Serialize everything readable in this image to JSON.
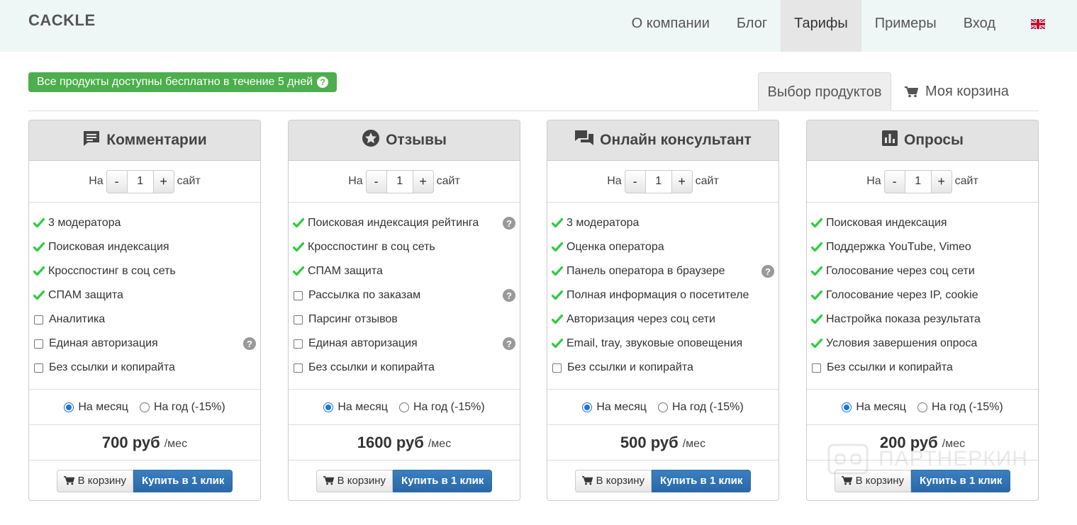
{
  "brand": "CACKLE",
  "nav": {
    "items": [
      "О компании",
      "Блог",
      "Тарифы",
      "Примеры",
      "Вход"
    ],
    "active": "Тарифы",
    "language_icon": "uk-flag-icon"
  },
  "promo": {
    "text": "Все продукты доступны бесплатно в течение 5 дней",
    "help_icon": "question-circle-icon"
  },
  "tabs": {
    "products": "Выбор продуктов",
    "cart": "Моя корзина"
  },
  "cards": [
    {
      "title": "Комментарии",
      "icon": "comment-icon",
      "qty_prefix": "На",
      "qty_value": "1",
      "qty_suffix": "сайт",
      "minus": "-",
      "plus": "+",
      "features": [
        {
          "label": "3 модератора",
          "included": true,
          "help": false
        },
        {
          "label": "Поисковая индексация",
          "included": true,
          "help": false
        },
        {
          "label": "Кросспостинг в соц сеть",
          "included": true,
          "help": false
        },
        {
          "label": "СПАМ защита",
          "included": true,
          "help": false
        },
        {
          "label": "Аналитика",
          "included": false,
          "help": false
        },
        {
          "label": "Единая авторизация",
          "included": false,
          "help": true
        },
        {
          "label": "Без ссылки и копирайта",
          "included": false,
          "help": false
        }
      ],
      "period_month": "На месяц",
      "period_year": "На год (-15%)",
      "price": "700 руб",
      "price_unit": "/мес",
      "cart_button": "В корзину",
      "buy_button": "Купить в 1 клик"
    },
    {
      "title": "Отзывы",
      "icon": "star-circle-icon",
      "qty_prefix": "На",
      "qty_value": "1",
      "qty_suffix": "сайт",
      "minus": "-",
      "plus": "+",
      "features": [
        {
          "label": "Поисковая индексация рейтинга",
          "included": true,
          "help": true
        },
        {
          "label": "Кросспостинг в соц сеть",
          "included": true,
          "help": false
        },
        {
          "label": "СПАМ защита",
          "included": true,
          "help": false
        },
        {
          "label": "Рассылка по заказам",
          "included": false,
          "help": true
        },
        {
          "label": "Парсинг отзывов",
          "included": false,
          "help": false
        },
        {
          "label": "Единая авторизация",
          "included": false,
          "help": true
        },
        {
          "label": "Без ссылки и копирайта",
          "included": false,
          "help": false
        }
      ],
      "period_month": "На месяц",
      "period_year": "На год (-15%)",
      "price": "1600 руб",
      "price_unit": "/мес",
      "cart_button": "В корзину",
      "buy_button": "Купить в 1 клик"
    },
    {
      "title": "Онлайн консультант",
      "icon": "chat-bubbles-icon",
      "qty_prefix": "На",
      "qty_value": "1",
      "qty_suffix": "сайт",
      "minus": "-",
      "plus": "+",
      "features": [
        {
          "label": "3 модератора",
          "included": true,
          "help": false
        },
        {
          "label": "Оценка оператора",
          "included": true,
          "help": false
        },
        {
          "label": "Панель оператора в браузере",
          "included": true,
          "help": true
        },
        {
          "label": "Полная информация о посетителе",
          "included": true,
          "help": false
        },
        {
          "label": "Авторизация через соц сети",
          "included": true,
          "help": false
        },
        {
          "label": "Email, tray, звуковые оповещения",
          "included": true,
          "help": false
        },
        {
          "label": "Без ссылки и копирайта",
          "included": false,
          "help": false
        }
      ],
      "period_month": "На месяц",
      "period_year": "На год (-15%)",
      "price": "500 руб",
      "price_unit": "/мес",
      "cart_button": "В корзину",
      "buy_button": "Купить в 1 клик"
    },
    {
      "title": "Опросы",
      "icon": "bar-chart-icon",
      "qty_prefix": "На",
      "qty_value": "1",
      "qty_suffix": "сайт",
      "minus": "-",
      "plus": "+",
      "features": [
        {
          "label": "Поисковая индексация",
          "included": true,
          "help": false
        },
        {
          "label": "Поддержка YouTube, Vimeo",
          "included": true,
          "help": false
        },
        {
          "label": "Голосование через соц сети",
          "included": true,
          "help": false
        },
        {
          "label": "Голосование через IP, cookie",
          "included": true,
          "help": false
        },
        {
          "label": "Настройка показа результата",
          "included": true,
          "help": false
        },
        {
          "label": "Условия завершения опроса",
          "included": true,
          "help": false
        },
        {
          "label": "Без ссылки и копирайта",
          "included": false,
          "help": false
        }
      ],
      "period_month": "На месяц",
      "period_year": "На год (-15%)",
      "price": "200 руб",
      "price_unit": "/мес",
      "cart_button": "В корзину",
      "buy_button": "Купить в 1 клик"
    }
  ],
  "watermark": "ПАРТНЕРКИН",
  "colors": {
    "header_bg": "#eef7f5",
    "promo_green": "#4cae4c",
    "check_green": "#2ecc40",
    "buy_blue": "#2a69a8",
    "radio_blue": "#1a73e8"
  }
}
